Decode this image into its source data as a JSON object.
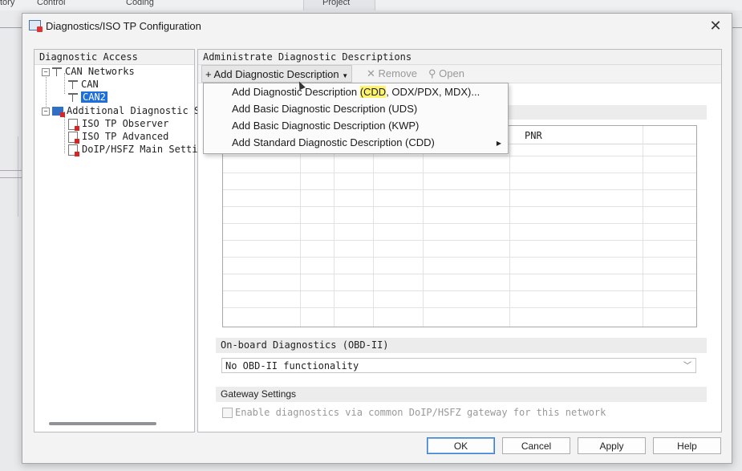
{
  "background_app": {
    "menu_items": [
      "tory",
      "Control",
      "Coding",
      "Project"
    ]
  },
  "dialog": {
    "title": "Diagnostics/ISO TP Configuration",
    "close_glyph": "✕"
  },
  "left_panel": {
    "header": "Diagnostic Access",
    "tree": {
      "can_networks": "CAN Networks",
      "can": "CAN",
      "can2": "CAN2",
      "additional": "Additional Diagnostic Se",
      "iso_tp_observer": "ISO TP Observer",
      "iso_tp_advanced": "ISO TP Advanced",
      "doip": "DoIP/HSFZ Main Settin"
    }
  },
  "right_panel": {
    "header": "Administrate Diagnostic Descriptions",
    "toolbar": {
      "add_label": "Add Diagnostic Description",
      "remove_label": "Remove",
      "open_label": "Open"
    },
    "table": {
      "column_pnr": "PNR"
    },
    "obd": {
      "section_title": "On-board Diagnostics (OBD-II)",
      "selected_value": "No OBD-II functionality"
    },
    "gateway": {
      "section_title": "Gateway Settings",
      "checkbox_label": "Enable diagnostics via common DoIP/HSFZ gateway for this network",
      "checked": false
    }
  },
  "dropdown_menu": {
    "item1_pre": "Add Diagnostic Description ",
    "item1_highlight": "(CDD",
    "item1_post": ", ODX/PDX, MDX)...",
    "item2": "Add Basic Diagnostic Description (UDS)",
    "item3": "Add Basic Diagnostic Description (KWP)",
    "item4": "Add Standard Diagnostic Description (CDD)"
  },
  "buttons": {
    "ok": "OK",
    "cancel": "Cancel",
    "apply": "Apply",
    "help": "Help"
  },
  "colors": {
    "selection": "#1e6fd9",
    "highlight": "#fff36b"
  }
}
